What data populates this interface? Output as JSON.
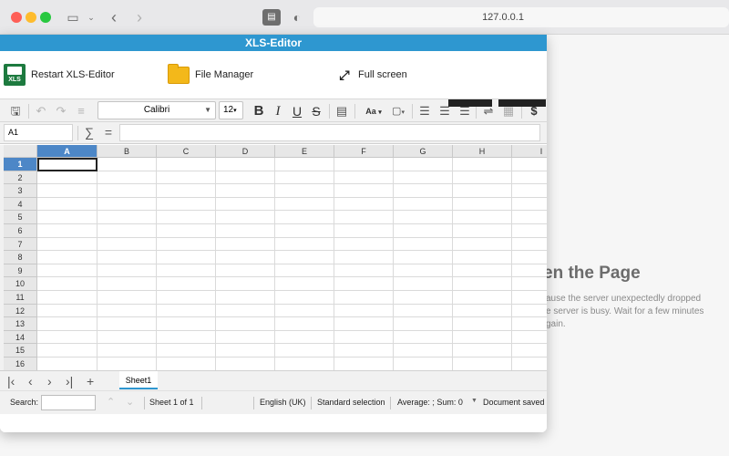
{
  "browser": {
    "url": "127.0.0.1"
  },
  "background_page": {
    "title_fragment": "en the Page",
    "body_lines": [
      "ause the server unexpectedly dropped",
      "e server is busy. Wait for a few minutes",
      "gain."
    ]
  },
  "window": {
    "title": "XLS-Editor"
  },
  "launcher": {
    "restart_label": "Restart XLS-Editor",
    "file_manager_label": "File Manager",
    "full_screen_label": "Full screen",
    "xls_icon_text": "XLS"
  },
  "toolbar": {
    "font_name": "Calibri",
    "font_size": "12",
    "aa_label": "Aa"
  },
  "formula_bar": {
    "cell_ref": "A1",
    "sum_symbol": "∑",
    "equals_symbol": "="
  },
  "grid": {
    "columns": [
      "A",
      "B",
      "C",
      "D",
      "E",
      "F",
      "G",
      "H",
      "I"
    ],
    "rows": [
      "1",
      "2",
      "3",
      "4",
      "5",
      "6",
      "7",
      "8",
      "9",
      "10",
      "11",
      "12",
      "13",
      "14",
      "15",
      "16"
    ],
    "selected_column": "A",
    "selected_row": "1"
  },
  "sheets": {
    "tabs": [
      "Sheet1"
    ],
    "add_symbol": "+"
  },
  "status": {
    "search_label": "Search:",
    "sheet_position": "Sheet 1 of 1",
    "language": "English (UK)",
    "selection_mode": "Standard selection",
    "summary": "Average: ; Sum: 0",
    "doc_state": "Document saved"
  }
}
